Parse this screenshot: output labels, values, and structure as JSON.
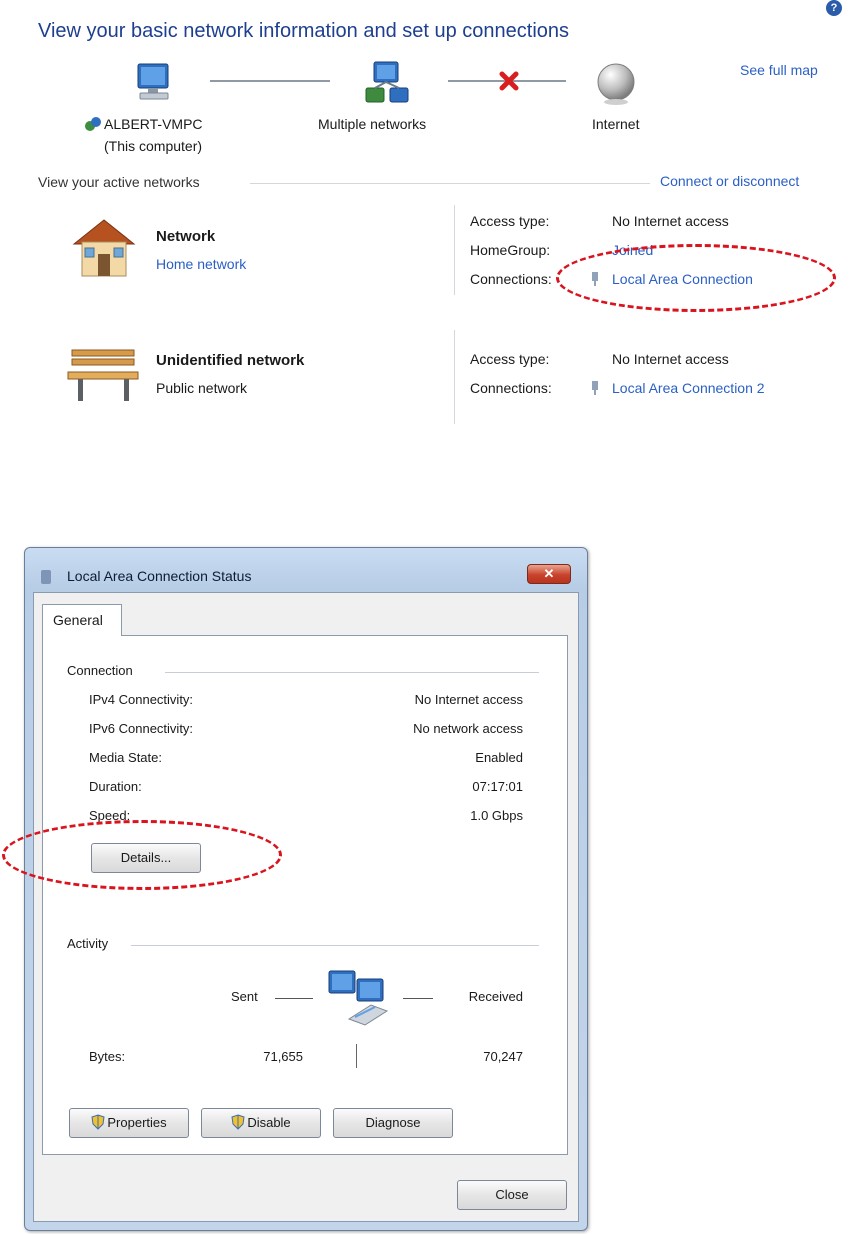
{
  "network_center": {
    "heading": "View your basic network information and set up connections",
    "help_icon": "help-icon",
    "map": {
      "computer_label": "ALBERT-VMPC",
      "computer_sublabel": "(This computer)",
      "networks_label": "Multiple networks",
      "internet_label": "Internet",
      "see_full_map": "See full map"
    },
    "active_networks_label": "View your active networks",
    "connect_or_disconnect": "Connect or disconnect",
    "networks": [
      {
        "name": "Network",
        "type": "Home network",
        "icon": "home-network-icon",
        "access_type_key": "Access type:",
        "access_type_value": "No Internet access",
        "homegroup_key": "HomeGroup:",
        "homegroup_value": "Joined",
        "connections_key": "Connections:",
        "connection_value": "Local Area Connection"
      },
      {
        "name": "Unidentified network",
        "type": "Public network",
        "icon": "public-network-bench-icon",
        "access_type_key": "Access type:",
        "access_type_value": "No Internet access",
        "connections_key": "Connections:",
        "connection_value": "Local Area Connection 2"
      }
    ]
  },
  "dialog": {
    "title": "Local Area Connection Status",
    "close_glyph": "✕",
    "tab": "General",
    "connection_group": "Connection",
    "rows": [
      {
        "key": "IPv4 Connectivity:",
        "value": "No Internet access"
      },
      {
        "key": "IPv6 Connectivity:",
        "value": "No network access"
      },
      {
        "key": "Media State:",
        "value": "Enabled"
      },
      {
        "key": "Duration:",
        "value": "07:17:01"
      },
      {
        "key": "Speed:",
        "value": "1.0 Gbps"
      }
    ],
    "details_button": "Details...",
    "activity_group": "Activity",
    "sent_label": "Sent",
    "received_label": "Received",
    "bytes_label": "Bytes:",
    "bytes_sent": "71,655",
    "bytes_received": "70,247",
    "properties_button": "Properties",
    "disable_button": "Disable",
    "diagnose_button": "Diagnose",
    "close_button": "Close"
  },
  "colors": {
    "heading_blue": "#1e3f8f",
    "link_blue": "#2a5fc4",
    "annotation_red": "#d9141e",
    "error_x_red": "#d81e1e"
  }
}
